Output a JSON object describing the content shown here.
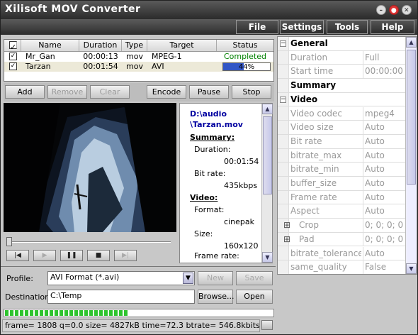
{
  "window": {
    "title": "Xilisoft MOV Converter"
  },
  "menu": [
    {
      "label": "File"
    },
    {
      "label": "Settings"
    },
    {
      "label": "Tools"
    },
    {
      "label": "Help"
    }
  ],
  "filelist": {
    "headers": [
      "Name",
      "Duration",
      "Type",
      "Target",
      "Status"
    ],
    "rows": [
      {
        "checked": true,
        "name": "Mr_Gan",
        "duration": "00:00:13",
        "type": "mov",
        "target": "MPEG-1",
        "status": "Completed"
      },
      {
        "checked": true,
        "name": "Tarzan",
        "duration": "00:01:54",
        "type": "mov",
        "target": "AVI",
        "status": "44%",
        "progress": 0.44
      }
    ]
  },
  "toolbar": {
    "add": "Add",
    "remove": "Remove",
    "clear": "Clear",
    "encode": "Encode",
    "pause": "Pause",
    "stop": "Stop"
  },
  "info": {
    "path1": "D:\\audio",
    "path2": "\\Tarzan.mov",
    "summary_h": "Summary:",
    "duration_l": "Duration:",
    "duration_v": "00:01:54",
    "bitrate_l": "Bit rate:",
    "bitrate_v": "435kbps",
    "video_h": "Video:",
    "format_l": "Format:",
    "format_v": "cinepak",
    "size_l": "Size:",
    "size_v": "160x120",
    "framerate_l": "Frame rate:"
  },
  "player": {
    "slider_position": 0.0
  },
  "bottom": {
    "profile_label": "Profile:",
    "profile_value": "AVI Format  (*.avi)",
    "new_btn": "New",
    "save_btn": "Save",
    "dest_label": "Destination:",
    "dest_value": "C:\\Temp",
    "browse_btn": "Browse...",
    "open_btn": "Open",
    "overall_progress": 0.46,
    "status_text": "frame= 1808 q=0.0 size=    4827kB time=72.3 btrate= 546.8kbits/s"
  },
  "properties": {
    "rows": [
      {
        "kind": "cat",
        "key": "General",
        "value": ""
      },
      {
        "kind": "prop",
        "key": "Duration",
        "value": "Full"
      },
      {
        "kind": "prop",
        "key": "Start time",
        "value": "00:00:00"
      },
      {
        "kind": "sub",
        "key": "Summary",
        "value": ""
      },
      {
        "kind": "cat",
        "key": "Video",
        "value": ""
      },
      {
        "kind": "prop",
        "key": "Video codec",
        "value": "mpeg4"
      },
      {
        "kind": "prop",
        "key": "Video size",
        "value": "Auto"
      },
      {
        "kind": "prop",
        "key": "Bit rate",
        "value": "Auto"
      },
      {
        "kind": "prop",
        "key": "bitrate_max",
        "value": "Auto"
      },
      {
        "kind": "prop",
        "key": "bitrate_min",
        "value": "Auto"
      },
      {
        "kind": "prop",
        "key": "buffer_size",
        "value": "Auto"
      },
      {
        "kind": "prop",
        "key": "Frame rate",
        "value": "Auto"
      },
      {
        "kind": "prop",
        "key": "Aspect",
        "value": "Auto"
      },
      {
        "kind": "exp",
        "key": "Crop",
        "value": "0; 0; 0; 0"
      },
      {
        "kind": "exp",
        "key": "Pad",
        "value": "0; 0; 0; 0"
      },
      {
        "kind": "prop",
        "key": "bitrate_tolerance",
        "value": "Auto"
      },
      {
        "kind": "prop",
        "key": "same_quality",
        "value": "False"
      }
    ]
  }
}
